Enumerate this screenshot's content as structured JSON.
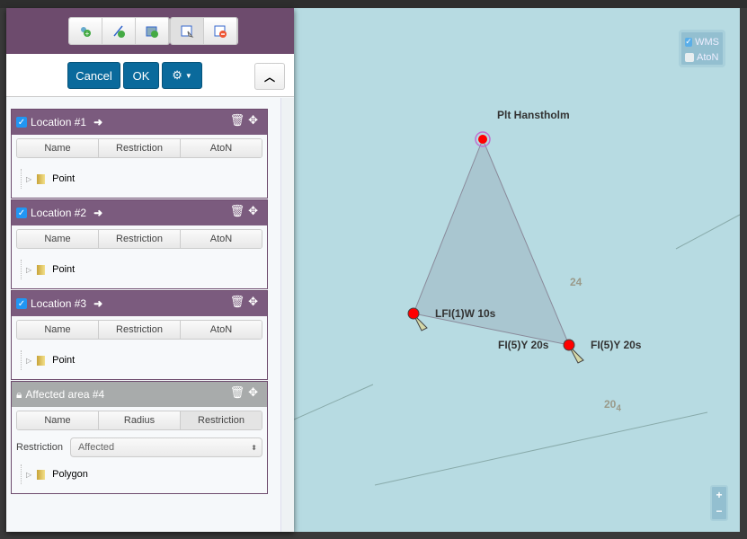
{
  "toolbar": {
    "tools": [
      {
        "icon": "add-point-icon"
      },
      {
        "icon": "add-line-icon"
      },
      {
        "icon": "add-polygon-icon"
      },
      {
        "icon": "select-feature-icon",
        "active": true
      },
      {
        "icon": "remove-feature-icon"
      }
    ]
  },
  "actions": {
    "cancel": "Cancel",
    "ok": "OK",
    "settings_icon": "gear-icon",
    "collapse_icon": "chevron-up-icon"
  },
  "locations": [
    {
      "title": "Location #1",
      "checked": true,
      "tabs": [
        "Name",
        "Restriction",
        "AtoN"
      ],
      "tree": "Point"
    },
    {
      "title": "Location #2",
      "checked": true,
      "tabs": [
        "Name",
        "Restriction",
        "AtoN"
      ],
      "tree": "Point"
    },
    {
      "title": "Location #3",
      "checked": true,
      "tabs": [
        "Name",
        "Restriction",
        "AtoN"
      ],
      "tree": "Point"
    }
  ],
  "area": {
    "title": "Affected area #4",
    "locked": true,
    "tabs": [
      "Name",
      "Radius",
      "Restriction"
    ],
    "restriction_label": "Restriction",
    "restriction_value": "Affected",
    "tree": "Polygon"
  },
  "map": {
    "layers": [
      {
        "label": "WMS",
        "checked": true
      },
      {
        "label": "AtoN",
        "checked": false
      }
    ],
    "labels": {
      "top": "Plt Hanstholm",
      "left": "LFI(1)W 10s",
      "right_a": "FI(5)Y 20s",
      "right_b": "FI(5)Y 20s"
    },
    "depths": {
      "d1": "24",
      "d2": "20",
      "d2_sub": "4"
    },
    "zoom_in": "+",
    "zoom_out": "−",
    "colors": {
      "water": "#b7dbe2",
      "polygon": "#a9c6d0",
      "light": "#ff0000"
    }
  }
}
